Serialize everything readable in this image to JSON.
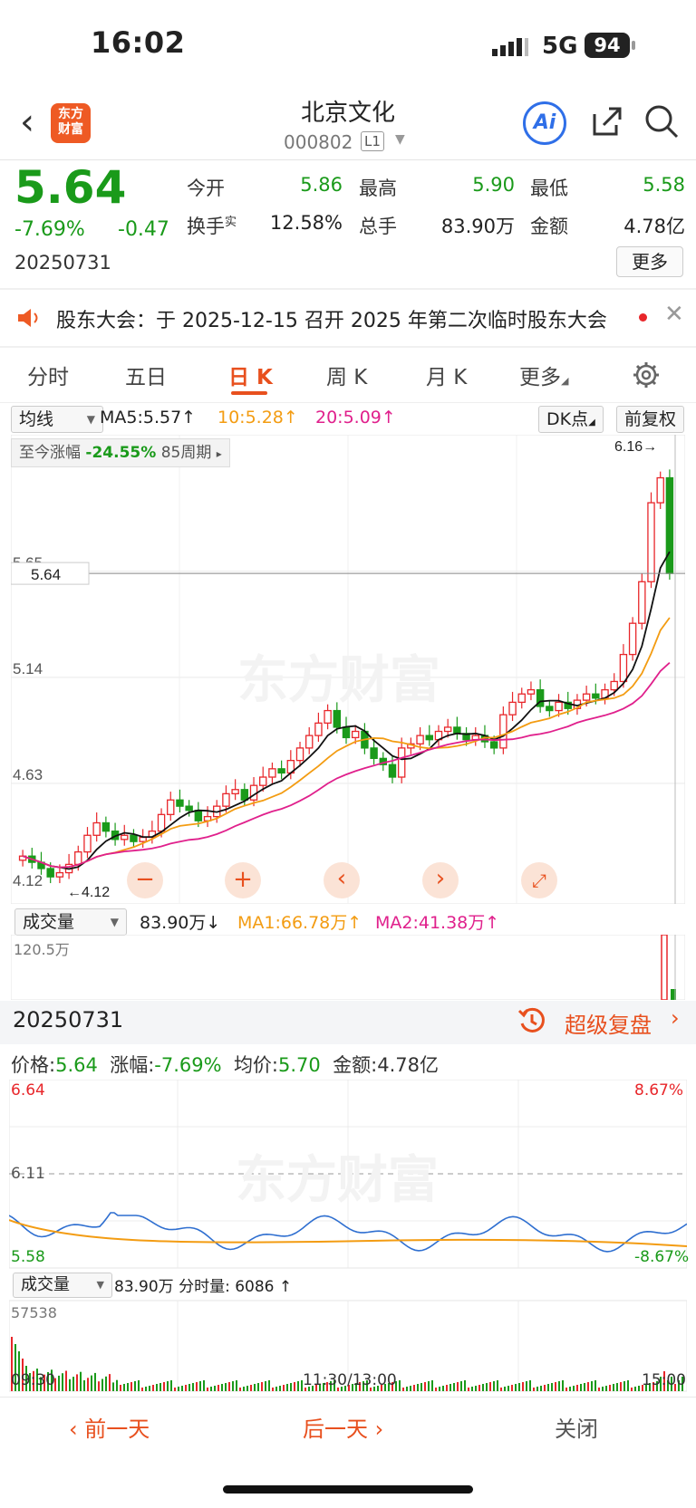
{
  "status": {
    "time": "16:02",
    "network": "5G",
    "battery": "94"
  },
  "header": {
    "logo": "东方\n财富",
    "name": "北京文化",
    "code": "000802",
    "level": "L1",
    "ai": "Ai"
  },
  "quote": {
    "price": "5.64",
    "pct": "-7.69%",
    "change": "-0.47",
    "date": "20250731",
    "labels": {
      "open": "今开",
      "high": "最高",
      "low": "最低",
      "turnover": "换手",
      "turnover_sup": "实",
      "volume": "总手",
      "amount": "金额"
    },
    "values": {
      "open": "5.86",
      "high": "5.90",
      "low": "5.58",
      "turnover": "12.58%",
      "volume": "83.90万",
      "amount": "4.78亿"
    },
    "more": "更多"
  },
  "notice": {
    "text": "股东大会：于 2025-12-15 召开 2025 年第二次临时股东大会"
  },
  "tabs": [
    "分时",
    "五日",
    "日 K",
    "周 K",
    "月 K",
    "更多"
  ],
  "kline": {
    "ma_select": "均线",
    "ma5": "MA5:5.57↑",
    "ma10": "10:5.28↑",
    "ma20": "20:5.09↑",
    "dk": "DK点",
    "adjust": "前复权",
    "range_label": "至今涨幅",
    "range_value": "-24.55%",
    "range_period": "85周期",
    "hi_label": "6.16→",
    "lo_label": "←4.12",
    "yticks": [
      "5.65",
      "5.14",
      "4.63",
      "4.12"
    ],
    "price_tag": "5.64",
    "watermark": "东方财富"
  },
  "volume": {
    "select": "成交量",
    "value": "83.90万↓",
    "ma1": "MA1:66.78万↑",
    "ma2": "MA2:41.38万↑",
    "ymax": "120.5万"
  },
  "detail": {
    "date": "20250731",
    "replay": "超级复盘",
    "price_label": "价格:",
    "price": "5.64",
    "pct_label": "涨幅:",
    "pct": "-7.69%",
    "avg_label": "均价:",
    "avg": "5.70",
    "amt_label": "金额:",
    "amt": "4.78亿",
    "y_top": "6.64",
    "y_mid": "6.11",
    "y_bot": "5.58",
    "pct_top": "8.67%",
    "pct_bot": "-8.67%",
    "vol_select": "成交量",
    "vol_info": "83.90万 分时量: 6086 ↑",
    "vol_max": "57538",
    "t_start": "09:30",
    "t_mid": "11:30/13:00",
    "t_end": "15:00"
  },
  "bottom": {
    "prev": "前一天",
    "next": "后一天",
    "close": "关闭"
  },
  "colors": {
    "up": "#e8262a",
    "down": "#1a9a1a",
    "accent": "#e8501e",
    "ma10": "#f39c12",
    "ma20": "#e0208c"
  }
}
